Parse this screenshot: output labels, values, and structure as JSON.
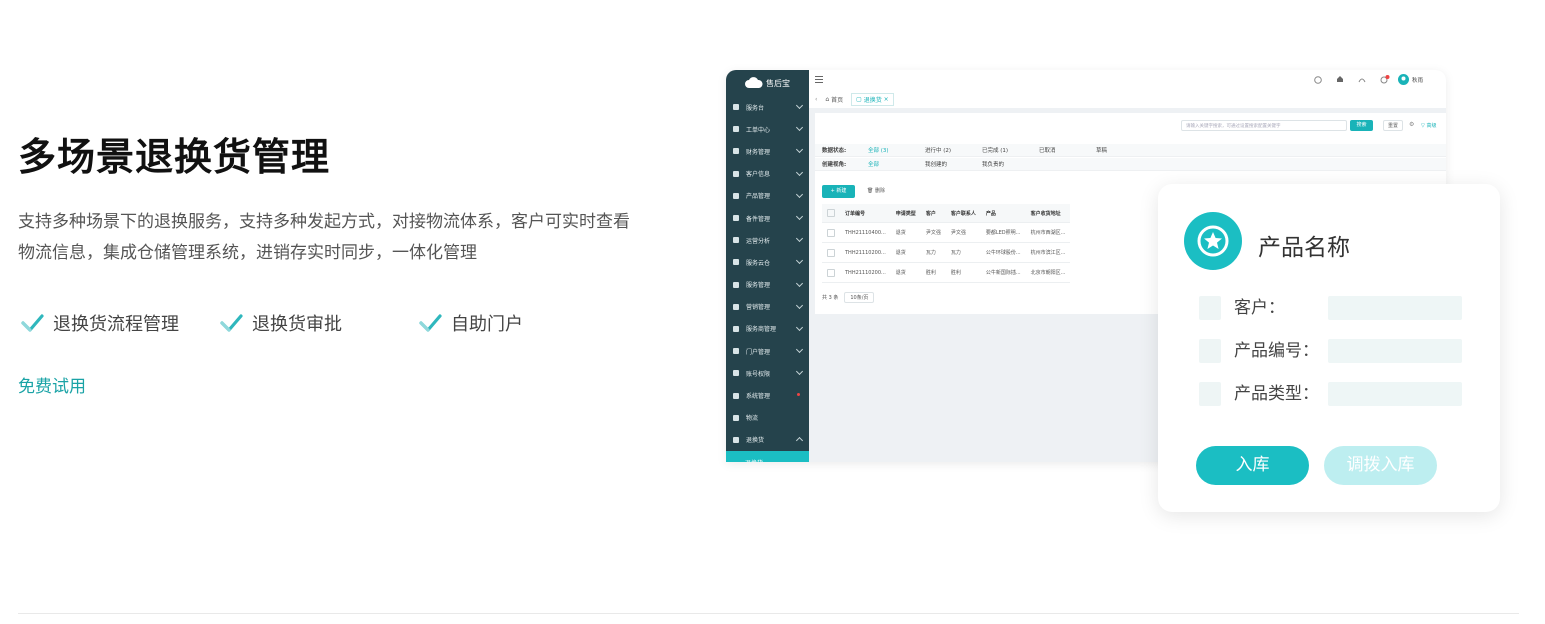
{
  "hero": {
    "title": "多场景退换货管理",
    "description": "支持多种场景下的退换服务，支持多种发起方式，对接物流体系，客户可实时查看物流信息，集成仓储管理系统，进销存实时同步，一体化管理",
    "features": [
      "退换货流程管理",
      "退换货审批",
      "自助门户"
    ],
    "cta": "免费试用"
  },
  "app": {
    "logo": "售后宝",
    "sidebar": [
      "服务台",
      "工单中心",
      "财务管理",
      "客户信息",
      "产品管理",
      "备件管理",
      "运营分析",
      "服务云仓",
      "服务管理",
      "营销管理",
      "服务商管理",
      "门户管理",
      "账号权限",
      "系统管理",
      "物流",
      "退换货"
    ],
    "sidebar_active": "退换货",
    "user": "秋雨",
    "tabs": [
      "首页",
      "退换货"
    ],
    "search_placeholder": "请输入关键字搜索，可通过设置搜索配置关键字",
    "search_btn": "搜索",
    "reset_btn": "重置",
    "advanced": "高级",
    "filters": {
      "status_label": "数据状态:",
      "status_opts": [
        "全部 (3)",
        "进行中 (2)",
        "已完成 (1)",
        "已取消",
        "草稿"
      ],
      "creator_label": "创建视角:",
      "creator_opts": [
        "全部",
        "我创建的",
        "我负责的"
      ]
    },
    "add_btn": "+ 新建",
    "del_btn": "删除",
    "columns": [
      "订单编号",
      "申请类型",
      "客户",
      "客户联系人",
      "产品",
      "客户收货地址"
    ],
    "rows": [
      [
        "THH21110400...",
        "退货",
        "尹文强",
        "尹文强",
        "要都LED照明...",
        "杭州市西湖区..."
      ],
      [
        "THH21110200...",
        "退货",
        "瓦力",
        "瓦力",
        "公牛环球股份...",
        "杭州市滨江区..."
      ],
      [
        "THH21110200...",
        "退货",
        "胜利",
        "胜利",
        "公牛新国际插...",
        "北京市朝阳区..."
      ]
    ],
    "total": "共 3 条",
    "page_size": "10条/页"
  },
  "card": {
    "title": "产品名称",
    "fields": [
      "客户：",
      "产品编号：",
      "产品类型："
    ],
    "btn_in": "入库",
    "btn_transfer": "调拨入库"
  },
  "colors": {
    "accent": "#1bbec3",
    "sidebar": "#25434c",
    "link": "#1aa3a6"
  }
}
